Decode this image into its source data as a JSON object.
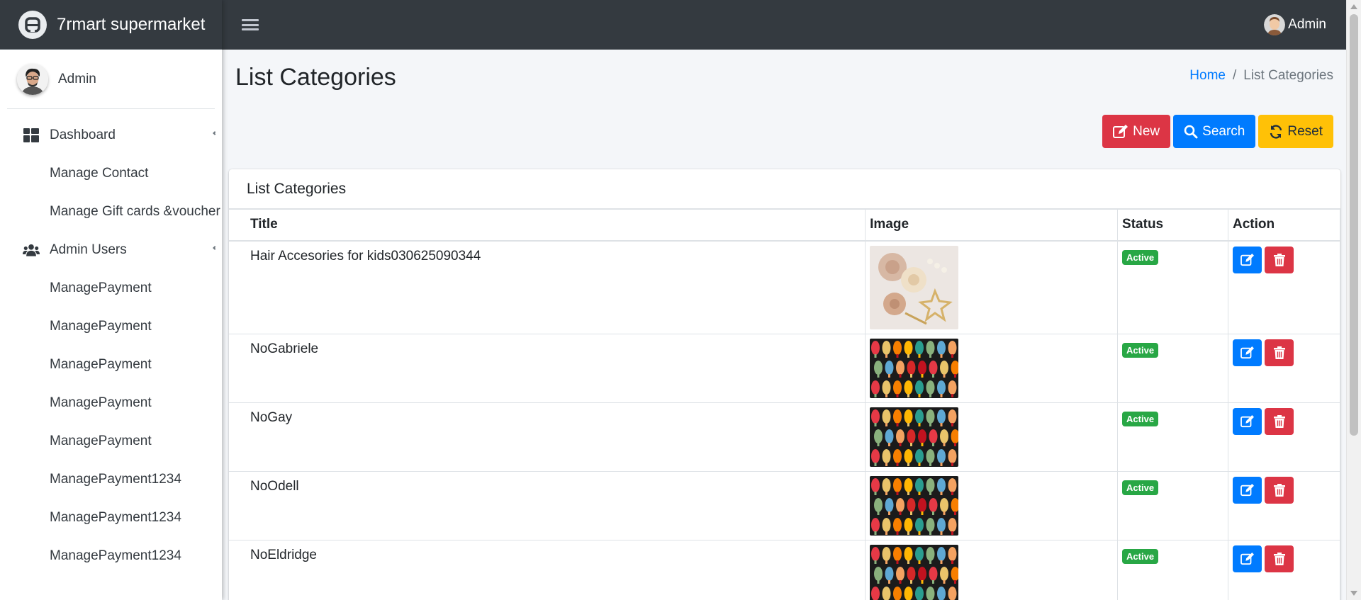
{
  "brand": {
    "name": "7rmart supermarket"
  },
  "sidebar": {
    "user_name": "Admin",
    "items": [
      {
        "label": "Dashboard",
        "icon": "dashboard-icon",
        "type": "main"
      },
      {
        "label": "Manage Contact",
        "type": "sub"
      },
      {
        "label": "Manage Gift cards &voucher",
        "type": "sub"
      },
      {
        "label": "Admin Users",
        "icon": "users-icon",
        "type": "main"
      },
      {
        "label": "ManagePayment",
        "type": "sub"
      },
      {
        "label": "ManagePayment",
        "type": "sub"
      },
      {
        "label": "ManagePayment",
        "type": "sub"
      },
      {
        "label": "ManagePayment",
        "type": "sub"
      },
      {
        "label": "ManagePayment",
        "type": "sub"
      },
      {
        "label": "ManagePayment1234",
        "type": "sub"
      },
      {
        "label": "ManagePayment1234",
        "type": "sub"
      },
      {
        "label": "ManagePayment1234",
        "type": "sub"
      }
    ]
  },
  "navbar": {
    "user_name": "Admin"
  },
  "page": {
    "title": "List Categories",
    "breadcrumb": {
      "home": "Home",
      "separator": "/",
      "current": "List Categories"
    }
  },
  "actions": {
    "new_label": "New",
    "search_label": "Search",
    "reset_label": "Reset"
  },
  "card": {
    "title": "List Categories",
    "columns": {
      "title": "Title",
      "image": "Image",
      "status": "Status",
      "action": "Action"
    },
    "rows": [
      {
        "title": "Hair Accesories for kids030625090344",
        "image": "hair-accessories-photo",
        "status": "Active"
      },
      {
        "title": "NoGabriele",
        "image": "colorful-lanterns-photo",
        "status": "Active"
      },
      {
        "title": "NoGay",
        "image": "colorful-lanterns-photo",
        "status": "Active"
      },
      {
        "title": "NoOdell",
        "image": "colorful-lanterns-photo",
        "status": "Active"
      },
      {
        "title": "NoEldridge",
        "image": "colorful-lanterns-photo",
        "status": "Active"
      }
    ]
  },
  "colors": {
    "navbar_bg": "#343a40",
    "primary": "#007bff",
    "danger": "#dc3545",
    "warning": "#ffc107",
    "success": "#28a745"
  }
}
